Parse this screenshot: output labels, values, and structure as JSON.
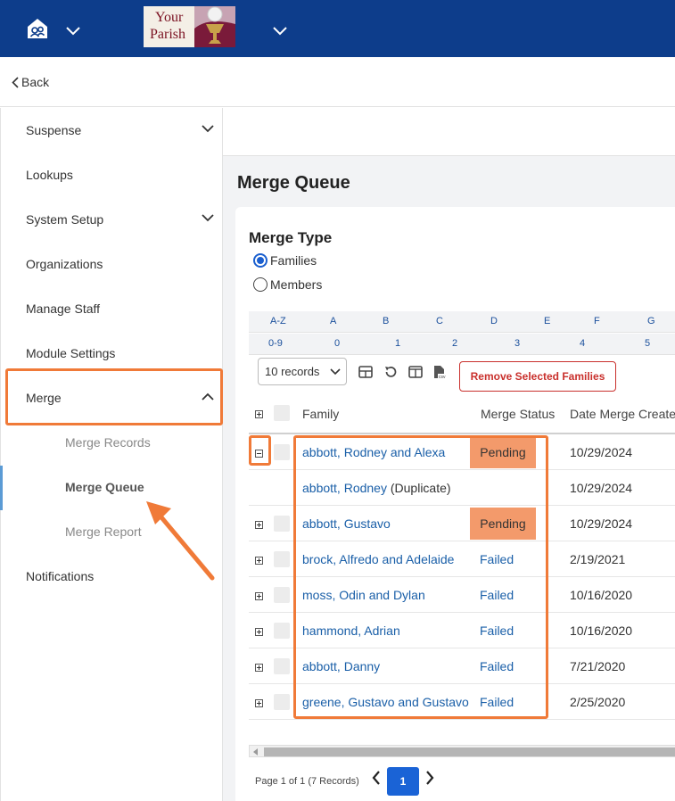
{
  "header": {
    "logo_line1": "Your",
    "logo_line2": "Parish",
    "brand_color": "#0d3d8b"
  },
  "nav": {
    "back_label": "Back"
  },
  "sidebar": {
    "items": [
      {
        "label": "Suspense",
        "has_children": true
      },
      {
        "label": "Lookups",
        "has_children": false
      },
      {
        "label": "System Setup",
        "has_children": true
      },
      {
        "label": "Organizations",
        "has_children": false
      },
      {
        "label": "Manage Staff",
        "has_children": false
      },
      {
        "label": "Module Settings",
        "has_children": false
      },
      {
        "label": "Merge",
        "has_children": true,
        "expanded": true
      },
      {
        "label": "Notifications",
        "has_children": false
      }
    ],
    "merge_children": [
      {
        "label": "Merge Records"
      },
      {
        "label": "Merge Queue",
        "active": true
      },
      {
        "label": "Merge Report"
      }
    ]
  },
  "main": {
    "page_title": "Merge Queue",
    "merge_type_label": "Merge Type",
    "radio_options": [
      {
        "label": "Families",
        "selected": true
      },
      {
        "label": "Members",
        "selected": false
      }
    ],
    "alpha_row1": [
      "A-Z",
      "A",
      "B",
      "C",
      "D",
      "E",
      "F",
      "G"
    ],
    "alpha_row2": [
      "0-9",
      "0",
      "1",
      "2",
      "3",
      "4",
      "5"
    ],
    "records_select": "10 records",
    "remove_button": "Remove Selected Families",
    "columns": [
      "Family",
      "Merge Status",
      "Date Merge Create"
    ],
    "rows": [
      {
        "family": "abbott, Rodney and Alexa",
        "status": "Pending",
        "date": "10/29/2024",
        "expander": "minus"
      },
      {
        "family": "abbott, Rodney",
        "dup": "(Duplicate)",
        "status": "",
        "date": "10/29/2024",
        "expander": "none"
      },
      {
        "family": "abbott, Gustavo",
        "status": "Pending",
        "date": "10/29/2024",
        "expander": "plus"
      },
      {
        "family": "brock, Alfredo and Adelaide",
        "status": "Failed",
        "date": "2/19/2021",
        "expander": "plus"
      },
      {
        "family": "moss, Odin and Dylan",
        "status": "Failed",
        "date": "10/16/2020",
        "expander": "plus"
      },
      {
        "family": "hammond, Adrian",
        "status": "Failed",
        "date": "10/16/2020",
        "expander": "plus"
      },
      {
        "family": "abbott, Danny",
        "status": "Failed",
        "date": "7/21/2020",
        "expander": "plus"
      },
      {
        "family": "greene, Gustavo and Gustavo",
        "status": "Failed",
        "date": "2/25/2020",
        "expander": "plus"
      }
    ],
    "pager_text": "Page 1 of 1 (7 Records)",
    "current_page": "1"
  },
  "colors": {
    "highlight": "#f07a38",
    "pending_bg": "#f39a6b",
    "link": "#1a5fa8",
    "danger": "#c9302c",
    "primary": "#1a63d6"
  }
}
